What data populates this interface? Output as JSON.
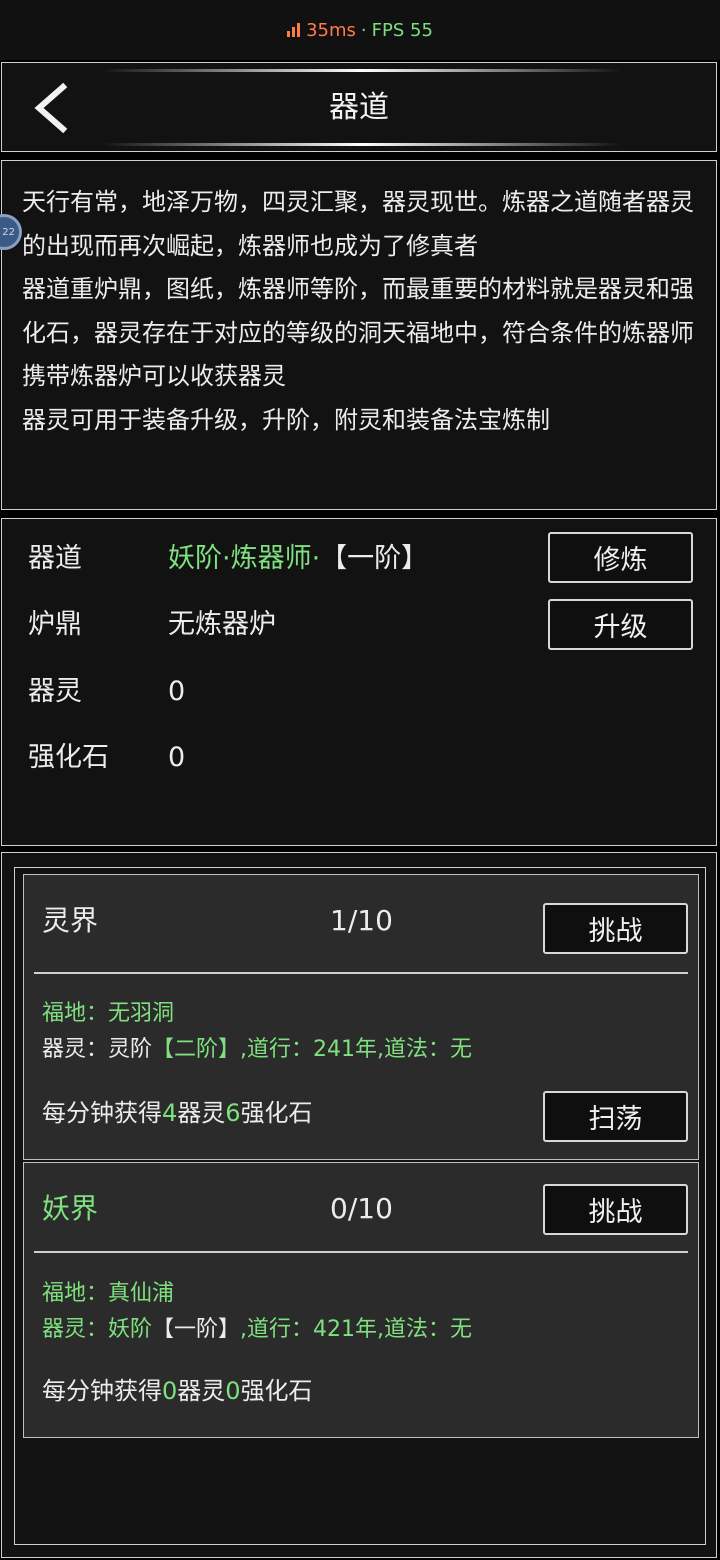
{
  "status": {
    "ping": "35ms",
    "separator": "·",
    "fps": "FPS 55"
  },
  "header": {
    "title": "器道"
  },
  "description": {
    "lines": [
      "天行有常，地泽万物，四灵汇聚，器灵现世。炼器之道随者器灵的出现而再次崛起，炼器师也成为了修真者",
      "器道重炉鼎，图纸，炼器师等阶，而最重要的材料就是器灵和强化石，器灵存在于对应的等级的洞天福地中，符合条件的炼器师携带炼器炉可以收获器灵",
      "器灵可用于装备升级，升阶，附灵和装备法宝炼制"
    ],
    "float_badge": "22"
  },
  "stats": {
    "qidao": {
      "label": "器道",
      "value": "妖阶·炼器师·",
      "rank": "【一阶】"
    },
    "luding": {
      "label": "炉鼎",
      "value": "无炼器炉"
    },
    "qiling": {
      "label": "器灵",
      "value": "0"
    },
    "qianghuashi": {
      "label": "强化石",
      "value": "0"
    },
    "train_label": "修炼",
    "upgrade_label": "升级"
  },
  "realms": [
    {
      "name": "灵界",
      "count": "1/10",
      "challenge_label": "挑战",
      "fudi": "福地：无羽洞",
      "qiling_prefix": "器灵：灵阶",
      "qiling_rank": "【二阶】",
      "qiling_suffix": ",道行：241年,道法：无",
      "gain_prefix": "每分钟获得",
      "gain_qiling": "4",
      "gain_mid": "器灵",
      "gain_stone": "6",
      "gain_suffix": "强化石",
      "sweep_label": "扫荡"
    },
    {
      "name": "妖界",
      "count": "0/10",
      "challenge_label": "挑战",
      "fudi": "福地：真仙浦",
      "qiling_prefix": "器灵：妖阶",
      "qiling_rank": "【一阶】",
      "qiling_suffix": ",道行：421年,道法：无",
      "gain_prefix": "每分钟获得",
      "gain_qiling": "0",
      "gain_mid": "器灵",
      "gain_stone": "0",
      "gain_suffix": "强化石"
    }
  ],
  "colors": {
    "accent_green": "#7ee07e",
    "ping_orange": "#ff7b4a"
  }
}
